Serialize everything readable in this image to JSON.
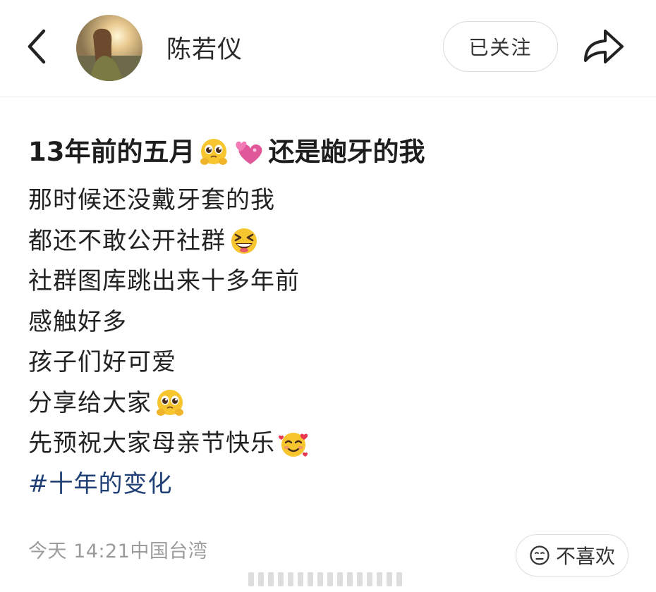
{
  "header": {
    "back_icon": "chevron-left-icon",
    "author_name": "陈若仪",
    "follow_label": "已关注",
    "share_icon": "share-arrow-icon"
  },
  "post": {
    "title_part1": "13年前的五月",
    "title_emoji1": "pleading-face-emoji",
    "title_emoji2": "two-hearts-emoji",
    "title_part2": "还是龅牙的我",
    "lines": [
      {
        "text": "那时候还没戴牙套的我",
        "emoji": ""
      },
      {
        "text": "都还不敢公开社群",
        "emoji": "grinning-squinting-face-emoji"
      },
      {
        "text": "社群图库跳出来十多年前",
        "emoji": ""
      },
      {
        "text": "感触好多",
        "emoji": ""
      },
      {
        "text": "孩子们好可爱",
        "emoji": ""
      },
      {
        "text": "分享给大家",
        "emoji": "pleading-face-emoji"
      },
      {
        "text": "先预祝大家母亲节快乐",
        "emoji": "smiling-face-with-hearts-emoji"
      }
    ],
    "hashtag": "#十年的变化"
  },
  "footer": {
    "timestamp": "今天 14:21",
    "location": "中国台湾",
    "dislike_label": "不喜欢",
    "dislike_icon": "neutral-face-icon"
  },
  "colors": {
    "hashtag": "#1f3f75",
    "meta_text": "#9b9b9b",
    "emoji_yellow": "#f7c52e",
    "heart_pink": "#e0579a"
  }
}
